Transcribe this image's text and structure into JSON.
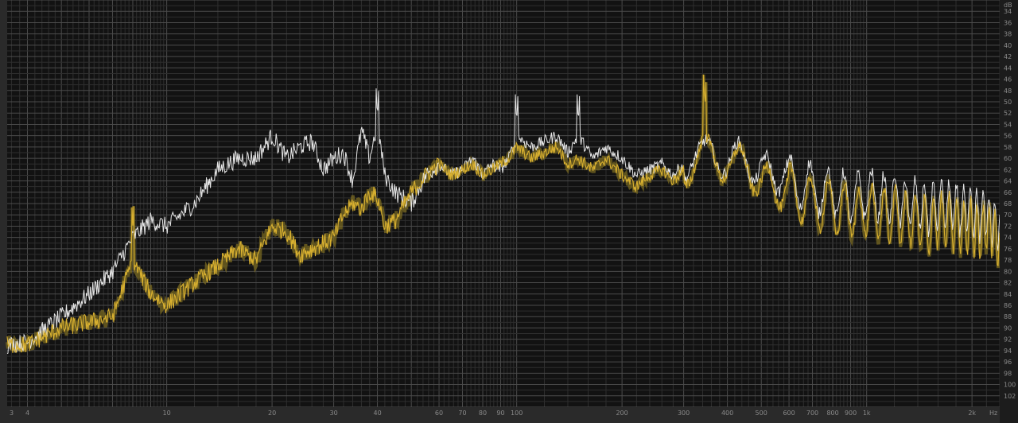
{
  "app": "spectrum-analyzer",
  "colors": {
    "background": "#121212",
    "frame": "#2a2a2a",
    "grid_major": "#4b4b4b",
    "grid_minor": "#2e2e2e",
    "label": "#8a8a8a",
    "series_white": "#e6e6e6",
    "series_gold": "#d8b030",
    "series_gold_band": "#7a6a22"
  },
  "chart_data": {
    "type": "line",
    "x_scale": "log",
    "grid": true,
    "xlim": [
      3.5,
      2400
    ],
    "ylim": [
      -104,
      -32
    ],
    "x_unit_label": "Hz",
    "y_unit_label": "dB",
    "x_ticks": [
      {
        "value": 3,
        "label": "3"
      },
      {
        "value": 4,
        "label": "4"
      },
      {
        "value": 10,
        "label": "10"
      },
      {
        "value": 20,
        "label": "20"
      },
      {
        "value": 30,
        "label": "30"
      },
      {
        "value": 40,
        "label": "40"
      },
      {
        "value": 60,
        "label": "60"
      },
      {
        "value": 70,
        "label": "70"
      },
      {
        "value": 80,
        "label": "80"
      },
      {
        "value": 90,
        "label": "90"
      },
      {
        "value": 100,
        "label": "100"
      },
      {
        "value": 200,
        "label": "200"
      },
      {
        "value": 300,
        "label": "300"
      },
      {
        "value": 400,
        "label": "400"
      },
      {
        "value": 500,
        "label": "500"
      },
      {
        "value": 600,
        "label": "600"
      },
      {
        "value": 700,
        "label": "700"
      },
      {
        "value": 800,
        "label": "800"
      },
      {
        "value": 900,
        "label": "900"
      },
      {
        "value": 1000,
        "label": "1k"
      },
      {
        "value": 2000,
        "label": "2k"
      }
    ],
    "y_ticks": [
      -34,
      -36,
      -38,
      -40,
      -42,
      -44,
      -46,
      -48,
      -50,
      -52,
      -54,
      -56,
      -58,
      -60,
      -62,
      -64,
      -66,
      -68,
      -70,
      -72,
      -74,
      -76,
      -78,
      -80,
      -82,
      -84,
      -86,
      -88,
      -90,
      -92,
      -94,
      -96,
      -98,
      -100,
      -102
    ],
    "series": [
      {
        "key": "white",
        "points": [
          [
            3.5,
            -93
          ],
          [
            4,
            -92.5
          ],
          [
            5,
            -88
          ],
          [
            6,
            -84
          ],
          [
            7,
            -80
          ],
          [
            8,
            -74
          ],
          [
            9,
            -71
          ],
          [
            10,
            -72
          ],
          [
            12,
            -68
          ],
          [
            14,
            -62
          ],
          [
            16,
            -60
          ],
          [
            18,
            -60
          ],
          [
            20,
            -56
          ],
          [
            22,
            -60
          ],
          [
            24,
            -58
          ],
          [
            26,
            -57
          ],
          [
            28,
            -62
          ],
          [
            30,
            -60
          ],
          [
            32,
            -59
          ],
          [
            34,
            -64
          ],
          [
            36,
            -55
          ],
          [
            38,
            -60
          ],
          [
            40,
            -54
          ],
          [
            42,
            -63
          ],
          [
            45,
            -66
          ],
          [
            50,
            -68
          ],
          [
            55,
            -63
          ],
          [
            60,
            -61
          ],
          [
            65,
            -63
          ],
          [
            70,
            -62
          ],
          [
            75,
            -60
          ],
          [
            80,
            -63
          ],
          [
            85,
            -61
          ],
          [
            90,
            -62
          ],
          [
            95,
            -60
          ],
          [
            100,
            -56
          ],
          [
            110,
            -58
          ],
          [
            120,
            -57
          ],
          [
            130,
            -56
          ],
          [
            140,
            -59
          ],
          [
            150,
            -56
          ],
          [
            165,
            -60
          ],
          [
            180,
            -58
          ],
          [
            200,
            -60
          ],
          [
            220,
            -63
          ],
          [
            240,
            -62
          ],
          [
            260,
            -61
          ],
          [
            280,
            -63
          ],
          [
            300,
            -61
          ],
          [
            320,
            -60
          ],
          [
            340,
            -60
          ],
          [
            360,
            -59
          ],
          [
            380,
            -60
          ],
          [
            400,
            -60
          ],
          [
            430,
            -60
          ],
          [
            460,
            -61
          ],
          [
            500,
            -62
          ],
          [
            540,
            -63
          ],
          [
            580,
            -63
          ],
          [
            620,
            -64
          ],
          [
            660,
            -65
          ],
          [
            700,
            -65
          ],
          [
            760,
            -66
          ],
          [
            820,
            -66
          ],
          [
            880,
            -67
          ],
          [
            950,
            -67
          ],
          [
            1000,
            -66
          ],
          [
            1100,
            -67
          ],
          [
            1200,
            -67
          ],
          [
            1300,
            -68
          ],
          [
            1400,
            -68
          ],
          [
            1500,
            -69
          ],
          [
            1600,
            -68
          ],
          [
            1700,
            -68
          ],
          [
            1800,
            -69
          ],
          [
            1900,
            -69
          ],
          [
            2000,
            -70
          ],
          [
            2100,
            -70
          ],
          [
            2200,
            -70
          ],
          [
            2300,
            -71
          ],
          [
            2400,
            -73
          ]
        ]
      },
      {
        "key": "gold",
        "points": [
          [
            3.5,
            -93
          ],
          [
            4,
            -93
          ],
          [
            5,
            -90
          ],
          [
            6,
            -89
          ],
          [
            7,
            -88
          ],
          [
            8,
            -78
          ],
          [
            9,
            -84
          ],
          [
            10,
            -86
          ],
          [
            12,
            -82
          ],
          [
            14,
            -79
          ],
          [
            16,
            -76
          ],
          [
            18,
            -78
          ],
          [
            20,
            -72
          ],
          [
            22,
            -73
          ],
          [
            24,
            -77
          ],
          [
            26,
            -76
          ],
          [
            28,
            -75
          ],
          [
            30,
            -74
          ],
          [
            32,
            -70
          ],
          [
            34,
            -68
          ],
          [
            36,
            -69
          ],
          [
            38,
            -66
          ],
          [
            40,
            -67
          ],
          [
            42,
            -72
          ],
          [
            45,
            -71
          ],
          [
            50,
            -66
          ],
          [
            55,
            -63
          ],
          [
            60,
            -61
          ],
          [
            65,
            -63
          ],
          [
            70,
            -62
          ],
          [
            75,
            -61
          ],
          [
            80,
            -63
          ],
          [
            85,
            -62
          ],
          [
            90,
            -61
          ],
          [
            95,
            -60
          ],
          [
            100,
            -58
          ],
          [
            110,
            -60
          ],
          [
            120,
            -59
          ],
          [
            130,
            -58
          ],
          [
            140,
            -61
          ],
          [
            150,
            -60
          ],
          [
            165,
            -62
          ],
          [
            180,
            -60
          ],
          [
            200,
            -63
          ],
          [
            220,
            -65
          ],
          [
            240,
            -63
          ],
          [
            260,
            -62
          ],
          [
            280,
            -64
          ],
          [
            300,
            -62
          ],
          [
            320,
            -61
          ],
          [
            340,
            -59
          ],
          [
            360,
            -60
          ],
          [
            380,
            -61
          ],
          [
            400,
            -60
          ],
          [
            430,
            -61
          ],
          [
            460,
            -62
          ],
          [
            500,
            -64
          ],
          [
            540,
            -65
          ],
          [
            580,
            -66
          ],
          [
            620,
            -66
          ],
          [
            660,
            -67
          ],
          [
            700,
            -68
          ],
          [
            760,
            -68
          ],
          [
            820,
            -69
          ],
          [
            880,
            -69
          ],
          [
            950,
            -70
          ],
          [
            1000,
            -69
          ],
          [
            1100,
            -70
          ],
          [
            1200,
            -70
          ],
          [
            1300,
            -71
          ],
          [
            1400,
            -71
          ],
          [
            1500,
            -72
          ],
          [
            1600,
            -71
          ],
          [
            1700,
            -71
          ],
          [
            1800,
            -72
          ],
          [
            1900,
            -72
          ],
          [
            2000,
            -72
          ],
          [
            2100,
            -73
          ],
          [
            2200,
            -72
          ],
          [
            2300,
            -73
          ],
          [
            2400,
            -75
          ]
        ]
      }
    ],
    "notable_peaks": [
      {
        "x": 40,
        "y": -53,
        "series": "white"
      },
      {
        "x": 8,
        "y": -72,
        "series": "gold"
      },
      {
        "x": 345,
        "y": -51,
        "series": "gold"
      },
      {
        "x": 100,
        "y": -54,
        "series": "white"
      },
      {
        "x": 150,
        "y": -54,
        "series": "white"
      }
    ]
  }
}
